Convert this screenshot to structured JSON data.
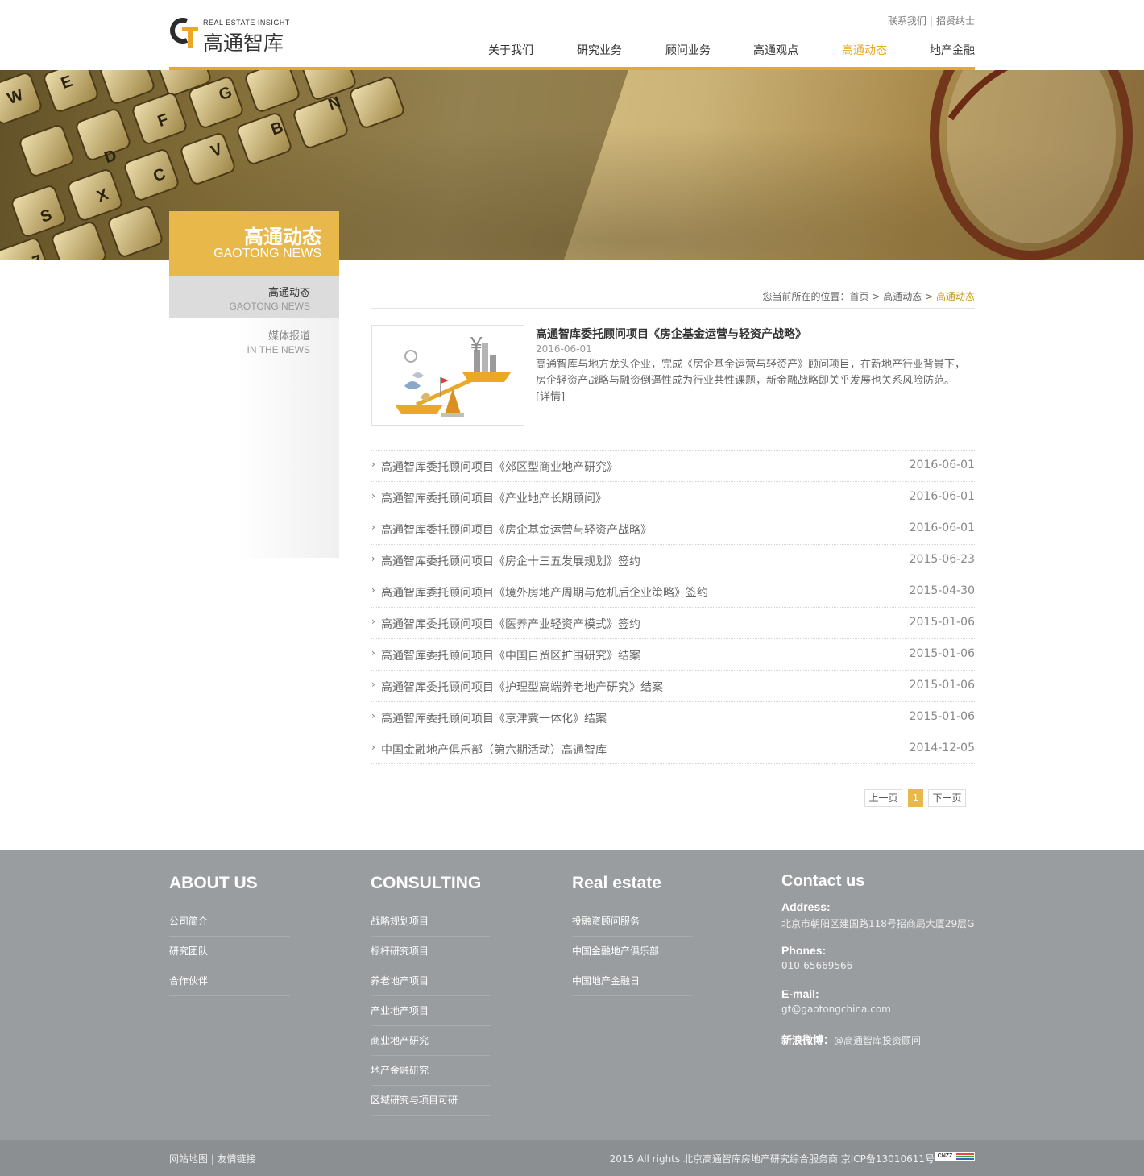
{
  "header": {
    "logo_tagline": "REAL ESTATE INSIGHT",
    "logo_name": "高通智库",
    "top_links": [
      "联系我们",
      "招贤纳士"
    ],
    "nav": [
      "关于我们",
      "研究业务",
      "顾问业务",
      "高通观点",
      "高通动态",
      "地产金融"
    ],
    "active_nav": "高通动态",
    "accent_color": "#e9a825"
  },
  "sidebar": {
    "title_cn": "高通动态",
    "title_en": "GAOTONG NEWS",
    "items": [
      {
        "cn": "高通动态",
        "en": "GAOTONG NEWS"
      },
      {
        "cn": "媒体报道",
        "en": "IN THE NEWS"
      }
    ]
  },
  "breadcrumb": {
    "prefix": "您当前所在的位置：",
    "home": "首页",
    "sep": ">",
    "section": "高通动态",
    "current": "高通动态"
  },
  "featured": {
    "title": "高通智库委托顾问项目《房企基金运营与轻资产战略》",
    "date": "2016-06-01",
    "desc": "高通智库与地方龙头企业，完成《房企基金运营与轻资产》顾问项目，在新地产行业背景下，房企轻资产战略与融资倒逼性成为行业共性课题，新金融战略即关乎发展也关系风险防范。",
    "more": "[详情]",
    "image_icon": "balance-scale-illustration"
  },
  "news": [
    {
      "title": "高通智库委托顾问项目《郊区型商业地产研究》",
      "date": "2016-06-01"
    },
    {
      "title": "高通智库委托顾问项目《产业地产长期顾问》",
      "date": "2016-06-01"
    },
    {
      "title": "高通智库委托顾问项目《房企基金运营与轻资产战略》",
      "date": "2016-06-01"
    },
    {
      "title": "高通智库委托顾问项目《房企十三五发展规划》签约",
      "date": "2015-06-23"
    },
    {
      "title": "高通智库委托顾问项目《境外房地产周期与危机后企业策略》签约",
      "date": "2015-04-30"
    },
    {
      "title": "高通智库委托顾问项目《医养产业轻资产模式》签约",
      "date": "2015-01-06"
    },
    {
      "title": "高通智库委托顾问项目《中国自贸区扩围研究》结案",
      "date": "2015-01-06"
    },
    {
      "title": "高通智库委托顾问项目《护理型高端养老地产研究》结案",
      "date": "2015-01-06"
    },
    {
      "title": "高通智库委托顾问项目《京津冀一体化》结案",
      "date": "2015-01-06"
    },
    {
      "title": "中国金融地产俱乐部（第六期活动）高通智库",
      "date": "2014-12-05"
    }
  ],
  "pager": {
    "prev": "上一页",
    "current": "1",
    "next": "下一页"
  },
  "footer": {
    "about": {
      "title": "ABOUT US",
      "items": [
        "公司简介",
        "研究团队",
        "合作伙伴"
      ]
    },
    "consulting": {
      "title": "CONSULTING",
      "items": [
        "战略规划项目",
        "标杆研究项目",
        "养老地产项目",
        "产业地产项目",
        "商业地产研究",
        "地产金融研究",
        "区域研究与项目可研"
      ]
    },
    "realestate": {
      "title": "Real estate",
      "items": [
        "投融资顾问服务",
        "中国金融地产俱乐部",
        "中国地产金融日"
      ]
    },
    "contact": {
      "title": "Contact us",
      "address_label": "Address:",
      "address": "北京市朝阳区建国路118号招商局大厦29层G",
      "phones_label": "Phones:",
      "phone": "010-65669566",
      "email_label": "E-mail:",
      "email": "gt@gaotongchina.com",
      "weibo_label": "新浪微博：",
      "weibo": "@高通智库投资顾问"
    }
  },
  "bottom": {
    "left": "网站地图 | 友情链接",
    "copyright": "2015 All rights 北京高通智库房地产研究综合服务商 京ICP备13010611号",
    "badge": "CNZZ"
  }
}
